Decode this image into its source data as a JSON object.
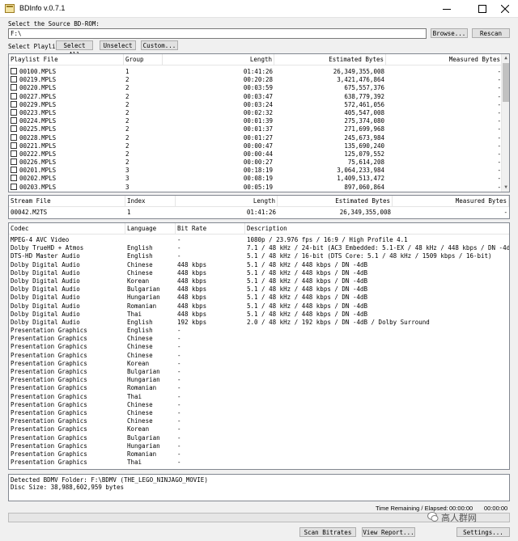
{
  "window": {
    "title": "BDInfo v.0.7.1"
  },
  "source": {
    "label": "Select the Source BD-ROM:",
    "path": "F:\\",
    "browse": "Browse...",
    "rescan": "Rescan"
  },
  "playlist_toolbar": {
    "label": "Select Playlist",
    "select_all": "Select All",
    "unselect": "Unselect",
    "custom": "Custom..."
  },
  "playlists": {
    "columns": [
      "Playlist File",
      "Group",
      "Length",
      "Estimated Bytes",
      "Measured Bytes"
    ],
    "rows": [
      [
        "00100.MPLS",
        "1",
        "01:41:26",
        "26,349,355,008",
        "-"
      ],
      [
        "00219.MPLS",
        "2",
        "00:20:28",
        "3,421,476,864",
        "-"
      ],
      [
        "00220.MPLS",
        "2",
        "00:03:59",
        "675,557,376",
        "-"
      ],
      [
        "00227.MPLS",
        "2",
        "00:03:47",
        "638,779,392",
        "-"
      ],
      [
        "00229.MPLS",
        "2",
        "00:03:24",
        "572,461,056",
        "-"
      ],
      [
        "00223.MPLS",
        "2",
        "00:02:32",
        "405,547,008",
        "-"
      ],
      [
        "00224.MPLS",
        "2",
        "00:01:39",
        "275,374,080",
        "-"
      ],
      [
        "00225.MPLS",
        "2",
        "00:01:37",
        "271,699,968",
        "-"
      ],
      [
        "00228.MPLS",
        "2",
        "00:01:27",
        "245,673,984",
        "-"
      ],
      [
        "00221.MPLS",
        "2",
        "00:00:47",
        "135,690,240",
        "-"
      ],
      [
        "00222.MPLS",
        "2",
        "00:00:44",
        "125,079,552",
        "-"
      ],
      [
        "00226.MPLS",
        "2",
        "00:00:27",
        "75,614,208",
        "-"
      ],
      [
        "00201.MPLS",
        "3",
        "00:18:19",
        "3,064,233,984",
        "-"
      ],
      [
        "00202.MPLS",
        "3",
        "00:08:19",
        "1,409,513,472",
        "-"
      ],
      [
        "00203.MPLS",
        "3",
        "00:05:19",
        "897,060,864",
        "-"
      ]
    ]
  },
  "streams": {
    "columns": [
      "Stream File",
      "Index",
      "Length",
      "Estimated Bytes",
      "Measured Bytes"
    ],
    "rows": [
      [
        "00042.M2TS",
        "1",
        "01:41:26",
        "26,349,355,008",
        "-"
      ]
    ]
  },
  "codecs": {
    "columns": [
      "Codec",
      "Language",
      "Bit Rate",
      "Description"
    ],
    "rows": [
      [
        "MPEG-4 AVC Video",
        "",
        "-",
        "1080p / 23.976 fps / 16:9 / High Profile 4.1"
      ],
      [
        "Dolby TrueHD + Atmos",
        "English",
        "-",
        "7.1 / 48 kHz / 24-bit (AC3 Embedded: 5.1-EX / 48 kHz / 448 kbps / DN -4dB)"
      ],
      [
        "DTS-HD Master Audio",
        "English",
        "-",
        "5.1 / 48 kHz / 16-bit (DTS Core: 5.1 / 48 kHz / 1509 kbps / 16-bit)"
      ],
      [
        "Dolby Digital Audio",
        "Chinese",
        "448 kbps",
        "5.1 / 48 kHz / 448 kbps / DN -4dB"
      ],
      [
        "Dolby Digital Audio",
        "Chinese",
        "448 kbps",
        "5.1 / 48 kHz / 448 kbps / DN -4dB"
      ],
      [
        "Dolby Digital Audio",
        "Korean",
        "448 kbps",
        "5.1 / 48 kHz / 448 kbps / DN -4dB"
      ],
      [
        "Dolby Digital Audio",
        "Bulgarian",
        "448 kbps",
        "5.1 / 48 kHz / 448 kbps / DN -4dB"
      ],
      [
        "Dolby Digital Audio",
        "Hungarian",
        "448 kbps",
        "5.1 / 48 kHz / 448 kbps / DN -4dB"
      ],
      [
        "Dolby Digital Audio",
        "Romanian",
        "448 kbps",
        "5.1 / 48 kHz / 448 kbps / DN -4dB"
      ],
      [
        "Dolby Digital Audio",
        "Thai",
        "448 kbps",
        "5.1 / 48 kHz / 448 kbps / DN -4dB"
      ],
      [
        "Dolby Digital Audio",
        "English",
        "192 kbps",
        "2.0 / 48 kHz / 192 kbps / DN -4dB / Dolby Surround"
      ],
      [
        "Presentation Graphics",
        "English",
        "-",
        ""
      ],
      [
        "Presentation Graphics",
        "Chinese",
        "-",
        ""
      ],
      [
        "Presentation Graphics",
        "Chinese",
        "-",
        ""
      ],
      [
        "Presentation Graphics",
        "Chinese",
        "-",
        ""
      ],
      [
        "Presentation Graphics",
        "Korean",
        "-",
        ""
      ],
      [
        "Presentation Graphics",
        "Bulgarian",
        "-",
        ""
      ],
      [
        "Presentation Graphics",
        "Hungarian",
        "-",
        ""
      ],
      [
        "Presentation Graphics",
        "Romanian",
        "-",
        ""
      ],
      [
        "Presentation Graphics",
        "Thai",
        "-",
        ""
      ],
      [
        "Presentation Graphics",
        "Chinese",
        "-",
        ""
      ],
      [
        "Presentation Graphics",
        "Chinese",
        "-",
        ""
      ],
      [
        "Presentation Graphics",
        "Chinese",
        "-",
        ""
      ],
      [
        "Presentation Graphics",
        "Korean",
        "-",
        ""
      ],
      [
        "Presentation Graphics",
        "Bulgarian",
        "-",
        ""
      ],
      [
        "Presentation Graphics",
        "Hungarian",
        "-",
        ""
      ],
      [
        "Presentation Graphics",
        "Romanian",
        "-",
        ""
      ],
      [
        "Presentation Graphics",
        "Thai",
        "-",
        ""
      ]
    ]
  },
  "log": {
    "line1": "Detected BDMV Folder: F:\\BDMV (THE_LEGO_NINJAGO_MOVIE)",
    "line2": "Disc Size: 38,988,602,959 bytes"
  },
  "status": {
    "time_label": "Time Remaining / Elapsed:",
    "remaining": "00:00:00",
    "elapsed": "00:00:00",
    "watermark": "高人群网"
  },
  "footer": {
    "scan": "Scan Bitrates",
    "report": "View Report...",
    "settings": "Settings..."
  },
  "colors": {
    "selection": "#cde8ff",
    "window_bg": "#f0f0f0",
    "border": "#828790"
  }
}
